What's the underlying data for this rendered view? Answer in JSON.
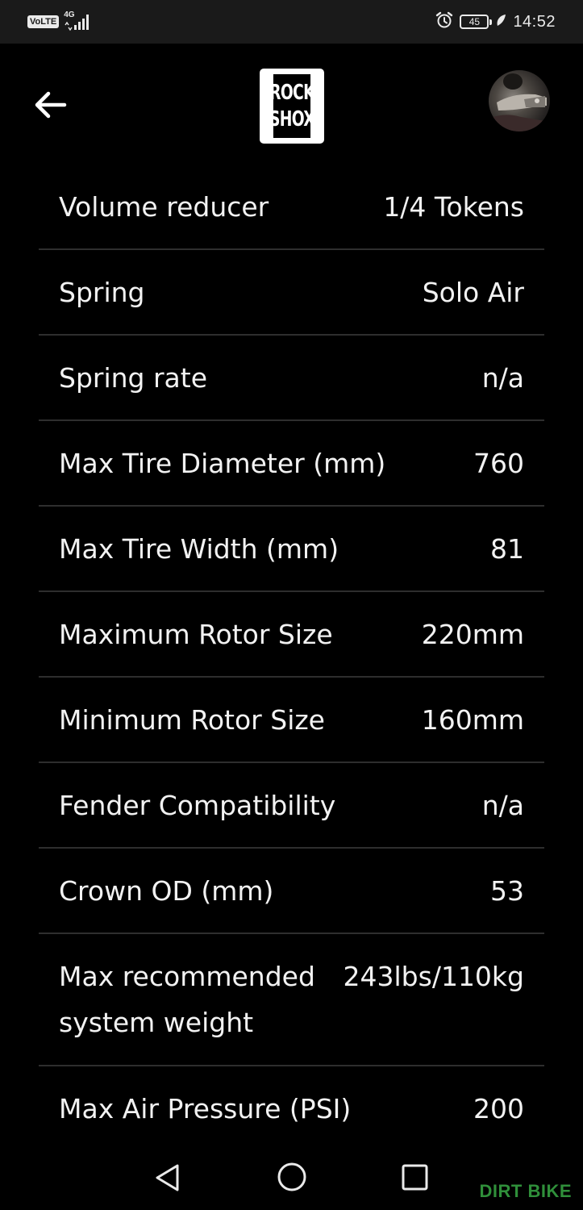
{
  "status_bar": {
    "volte": "VoLTE",
    "network": "4G",
    "battery": "45",
    "time": "14:52"
  },
  "header": {
    "logo_line1": "ROCK",
    "logo_line2": "SHOX",
    "back_icon": "arrow-left-icon",
    "avatar_alt": "profile avatar"
  },
  "specs": [
    {
      "label": "Volume reducer",
      "value": "1/4 Tokens"
    },
    {
      "label": "Spring",
      "value": "Solo Air"
    },
    {
      "label": "Spring rate",
      "value": "n/a"
    },
    {
      "label": "Max Tire Diameter (mm)",
      "value": "760"
    },
    {
      "label": "Max Tire Width (mm)",
      "value": "81"
    },
    {
      "label": "Maximum Rotor Size",
      "value": "220mm"
    },
    {
      "label": "Minimum Rotor Size",
      "value": "160mm"
    },
    {
      "label": "Fender Compatibility",
      "value": "n/a"
    },
    {
      "label": "Crown OD (mm)",
      "value": "53"
    },
    {
      "label": "Max recommended system weight",
      "value": "243lbs/110kg"
    },
    {
      "label": "Max Air Pressure (PSI)",
      "value": "200"
    }
  ],
  "nav_bar": {
    "back_icon": "triangle-back-icon",
    "home_icon": "circle-home-icon",
    "recents_icon": "square-recents-icon"
  },
  "watermark": "DIRT BIKE"
}
